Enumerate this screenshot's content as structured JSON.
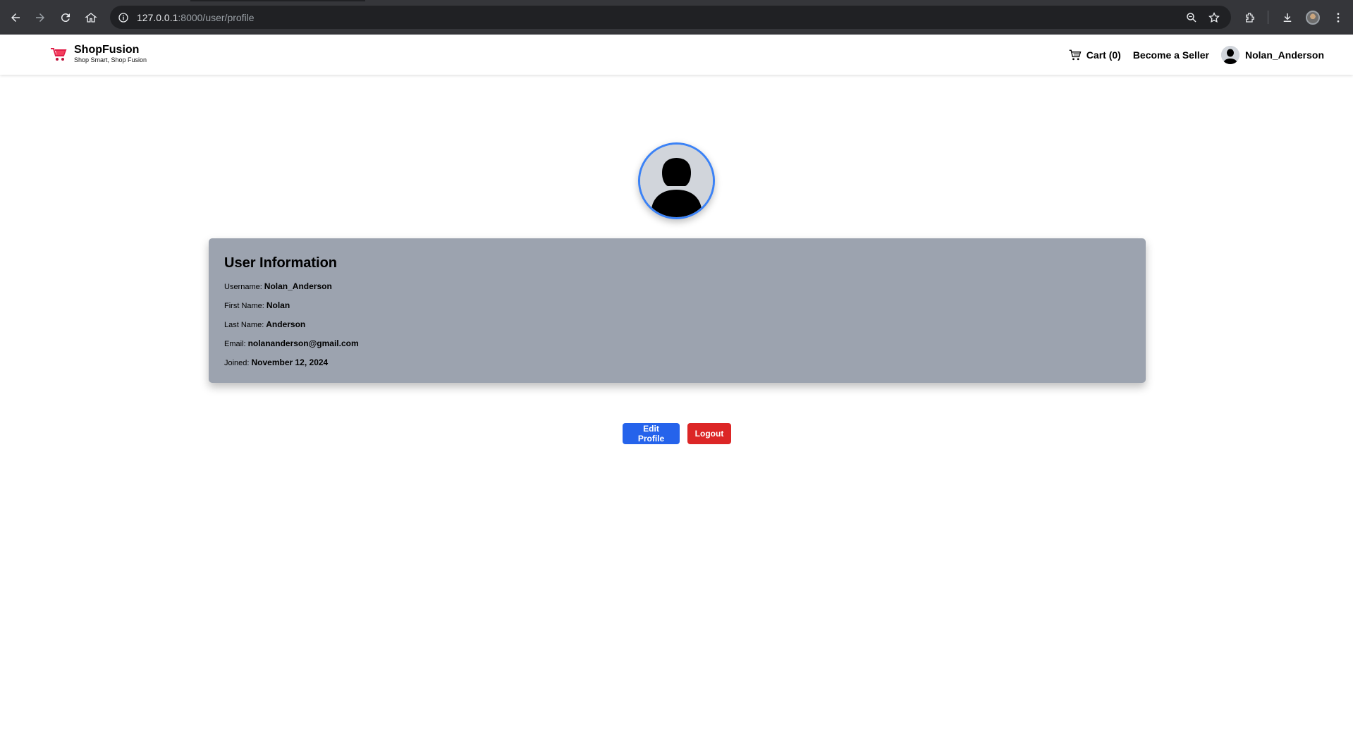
{
  "browser": {
    "url_host": "127.0.0.1",
    "url_path": ":8000/user/profile"
  },
  "header": {
    "brand_name": "ShopFusion",
    "brand_tagline": "Shop Smart, Shop Fusion",
    "cart_label": "Cart (0)",
    "seller_label": "Become a Seller",
    "username": "Nolan_Anderson"
  },
  "profile": {
    "title": "User Information",
    "fields": [
      {
        "label": "Username:",
        "value": "Nolan_Anderson"
      },
      {
        "label": "First Name:",
        "value": "Nolan"
      },
      {
        "label": "Last Name:",
        "value": "Anderson"
      },
      {
        "label": "Email:",
        "value": "nolananderson@gmail.com"
      },
      {
        "label": "Joined:",
        "value": "November 12, 2024"
      }
    ],
    "edit_label": "Edit Profile",
    "logout_label": "Logout"
  },
  "colors": {
    "accent_blue": "#2563eb",
    "danger_red": "#dc2626",
    "card_gray": "#9ca3af",
    "avatar_ring": "#3b82f6"
  }
}
